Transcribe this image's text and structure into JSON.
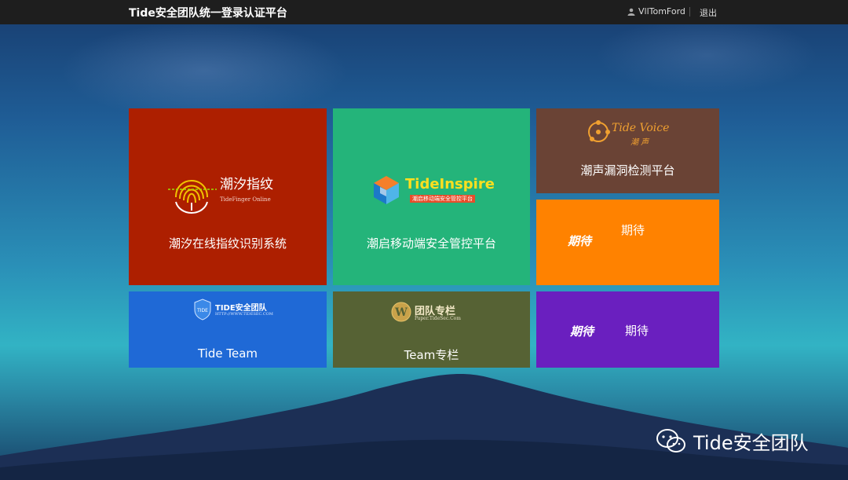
{
  "header": {
    "title": "Tide安全团队统一登录认证平台",
    "username": "VllTomFord",
    "logout_label": "退出"
  },
  "tiles": [
    {
      "id": "fingerprint",
      "label": "潮汐在线指纹识别系统",
      "logo_title": "潮汐指纹",
      "logo_sub": "TideFinger Online",
      "color": "#ad1f00"
    },
    {
      "id": "inspire",
      "label": "潮启移动端安全管控平台",
      "logo_title": "TideInspire",
      "logo_sub": "潮启移动端安全管控平台",
      "color": "#24b47a"
    },
    {
      "id": "voice",
      "label": "潮声漏洞检测平台",
      "logo_title": "Tide Voice",
      "logo_sub": "潮 声",
      "color": "#6a4335"
    },
    {
      "id": "expect1",
      "label": "期待",
      "logo_title": "期待",
      "color": "#ff8200"
    },
    {
      "id": "team",
      "label": "Tide Team",
      "logo_title": "TIDE安全团队",
      "logo_sub": "HTTP://WWW.TIDESEC.COM",
      "color": "#1f69d6"
    },
    {
      "id": "column",
      "label": "Team专栏",
      "logo_title": "团队专栏",
      "logo_sub": "Paper.TideSec.Com",
      "color": "#566234"
    },
    {
      "id": "expect2",
      "label": "期待",
      "logo_title": "期待",
      "color": "#6a1fbf"
    }
  ],
  "watermark": {
    "text": "Tide安全团队",
    "icon": "wechat-icon"
  }
}
